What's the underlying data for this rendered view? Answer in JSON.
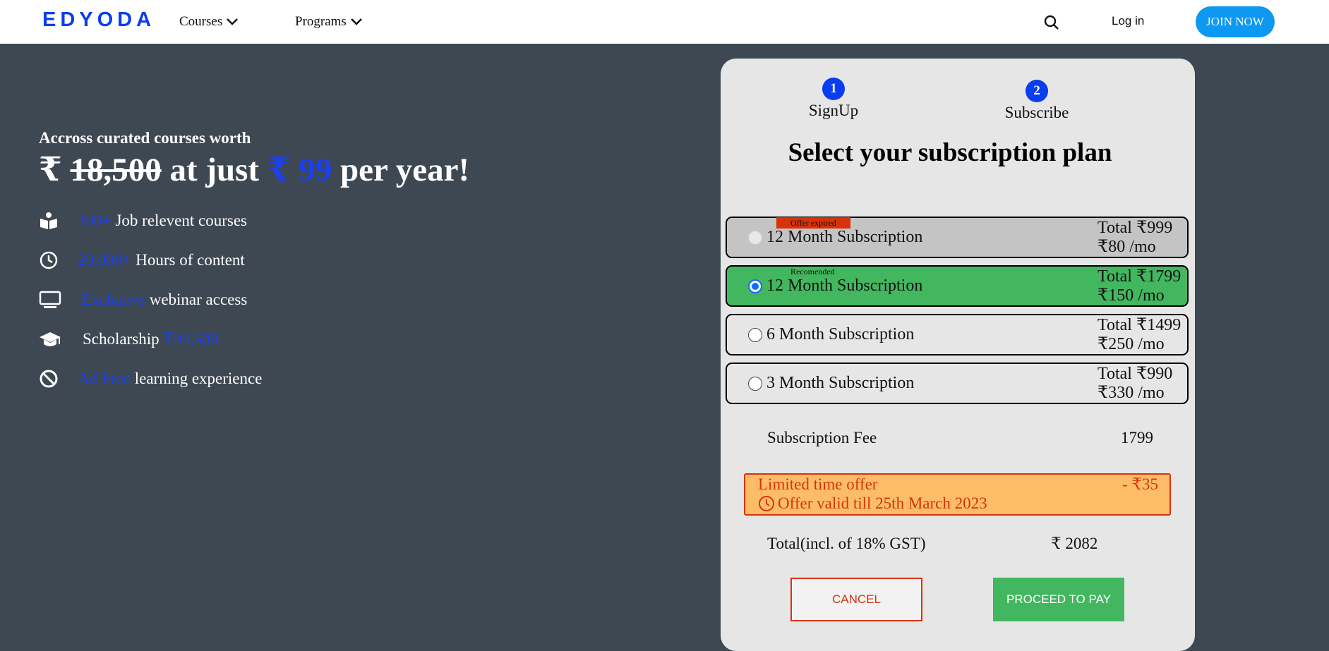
{
  "nav": {
    "logo": "EDYODA",
    "courses": "Courses",
    "programs": "Programs",
    "login": "Log in",
    "join": "JOIN NOW"
  },
  "hero": {
    "subtitle": "Accross curated courses worth",
    "currency": "₹",
    "old_price": "18,500",
    "at_just": "at just",
    "new_price": "₹ 99",
    "per_year": "per year!"
  },
  "features": [
    {
      "icon": "book-reader-icon",
      "highlight": "100+",
      "text": "Job relevent courses"
    },
    {
      "icon": "clock-icon",
      "highlight": "20,000+",
      "text": "Hours of content"
    },
    {
      "icon": "monitor-icon",
      "highlight": "Exclusive",
      "text": "webinar access"
    },
    {
      "icon": "graduation-cap-icon",
      "pre": "Scholarship",
      "highlight": "₹94,500"
    },
    {
      "icon": "no-ads-icon",
      "highlight": "Ad Free",
      "text": "learning experience"
    }
  ],
  "card": {
    "steps": [
      {
        "num": "1",
        "label": "SignUp"
      },
      {
        "num": "2",
        "label": "Subscribe"
      }
    ],
    "title": "Select your subscription plan",
    "plans": [
      {
        "tag": "Offer expired",
        "name": "12 Month Subscription",
        "total": "Total ₹999",
        "monthly": "₹80 /mo",
        "state": "expired"
      },
      {
        "tag": "Recomended",
        "name": "12 Month Subscription",
        "total": "Total ₹1799",
        "monthly": "₹150 /mo",
        "state": "selected"
      },
      {
        "tag": "",
        "name": "6 Month Subscription",
        "total": "Total ₹1499",
        "monthly": "₹250 /mo",
        "state": "normal"
      },
      {
        "tag": "",
        "name": "3 Month Subscription",
        "total": "Total ₹990",
        "monthly": "₹330 /mo",
        "state": "normal"
      }
    ],
    "fee_label": "Subscription Fee",
    "fee_value": "1799",
    "offer_label": "Limited time offer",
    "offer_discount": "- ₹35",
    "offer_valid": "Offer valid till 25th March 2023",
    "total_label": "Total(incl. of 18% GST)",
    "total_value": "₹ 2082",
    "cancel": "CANCEL",
    "pay": "PROCEED TO PAY"
  },
  "colors": {
    "brand_blue": "#0a3df0",
    "bg": "#3d4852",
    "recommended_green": "#43b75f",
    "expired_grey": "#c4c4c4",
    "offer_orange": "#fdbd68",
    "offer_red": "#d6330b",
    "join_blue": "#0d99f2"
  }
}
